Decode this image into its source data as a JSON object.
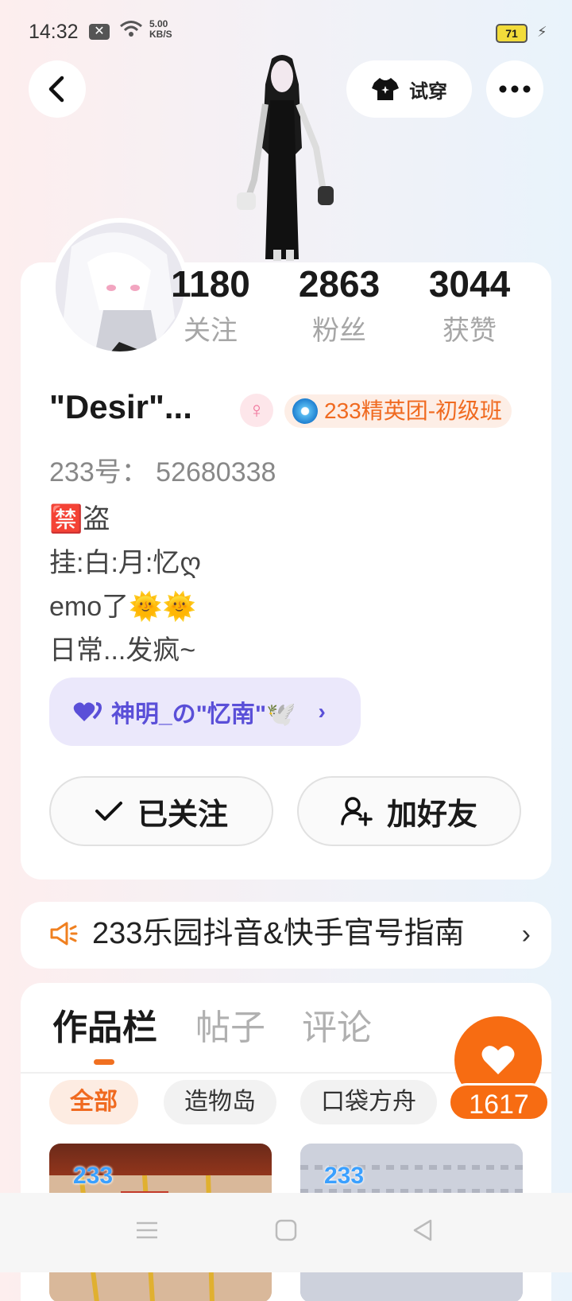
{
  "status_bar": {
    "time": "14:32",
    "net_speed_value": "5.00",
    "net_speed_unit": "KB/S",
    "battery": "71"
  },
  "header": {
    "try_on_label": "试穿"
  },
  "stats": [
    {
      "value": "1180",
      "label": "关注"
    },
    {
      "value": "2863",
      "label": "粉丝"
    },
    {
      "value": "3044",
      "label": "获赞"
    }
  ],
  "profile": {
    "name": "\"Desir\"...",
    "gender_symbol": "♀",
    "rank_badge": "233精英团-初级班",
    "user_id": "233号： 52680338",
    "bio": [
      "🈲盗",
      "挂:白:月:忆ღ",
      "emo了🌞🌞",
      "日常...发疯~"
    ],
    "guild": "神明_の\"忆南\"🕊️"
  },
  "actions": {
    "follow_label": "已关注",
    "add_friend_label": "加好友"
  },
  "notice": {
    "text": "233乐园抖音&快手官号指南"
  },
  "works": {
    "tabs": [
      "作品栏",
      "帖子",
      "评论"
    ],
    "filters": [
      "全部",
      "造物岛",
      "口袋方舟"
    ],
    "thumb_logo": "233"
  },
  "like": {
    "count": "1617"
  },
  "colors": {
    "accent": "#f76c12",
    "guild_text": "#5a4fd8"
  }
}
